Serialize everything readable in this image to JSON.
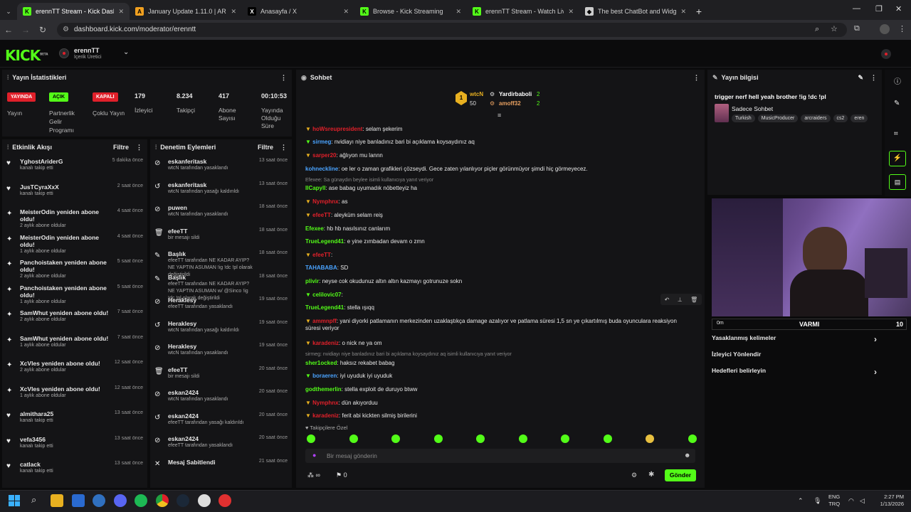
{
  "browser": {
    "tabs": [
      {
        "title": "erennTT Stream - Kick Dashboa",
        "color": "#53fc18",
        "glyph": "K"
      },
      {
        "title": "January Update 1.11.0 | ARC Ra",
        "color": "#f0a020",
        "glyph": "A"
      },
      {
        "title": "Anasayfa / X",
        "color": "#000000",
        "glyph": "X"
      },
      {
        "title": "Browse - Kick Streaming",
        "color": "#53fc18",
        "glyph": "K"
      },
      {
        "title": "erennTT Stream - Watch Live o",
        "color": "#53fc18",
        "glyph": "K"
      },
      {
        "title": "The best ChatBot and Widgets",
        "color": "#cccccc",
        "glyph": "◆"
      }
    ],
    "url": "dashboard.kick.com/moderator/erenntt"
  },
  "header": {
    "logo": "KICK",
    "beta": "BETA",
    "channel": "erennTT",
    "role": "İçerik Üretici"
  },
  "stats": {
    "title": "Yayın İstatistikleri",
    "items": [
      {
        "badge": "YAYINDA",
        "badge_color": "#e0202a",
        "label": "Yayın"
      },
      {
        "badge": "AÇIK",
        "badge_color": "#53fc18",
        "label": "Partnerlik Gelir Programı"
      },
      {
        "badge": "KAPALI",
        "badge_color": "#e0202a",
        "label": "Çoklu Yayın"
      }
    ],
    "nums": [
      {
        "value": "179",
        "label": "İzleyici"
      },
      {
        "value": "8.234",
        "label": "Takipçi"
      },
      {
        "value": "417",
        "label": "Abone Sayısı"
      },
      {
        "value": "00:10:53",
        "label": "Yayında Olduğu Süre"
      }
    ]
  },
  "activity": {
    "title": "Etkinlik Akışı",
    "filter": "Filtre",
    "items": [
      {
        "icon": "♥",
        "name": "YghostAriderG",
        "sub": "kanalı takip etti",
        "time": "5 dakika önce"
      },
      {
        "icon": "♥",
        "name": "JusTCyraXxX",
        "sub": "kanalı takip etti",
        "time": "2 saat önce"
      },
      {
        "icon": "✦",
        "name": "MeisterOdin yeniden abone oldu!",
        "sub": "2 aylık abone oldular",
        "time": "4 saat önce"
      },
      {
        "icon": "✦",
        "name": "MeisterOdin yeniden abone oldu!",
        "sub": "1 aylık abone oldular",
        "time": "4 saat önce"
      },
      {
        "icon": "✦",
        "name": "Panchoistaken yeniden abone oldu!",
        "sub": "2 aylık abone oldular",
        "time": "5 saat önce"
      },
      {
        "icon": "✦",
        "name": "Panchoistaken yeniden abone oldu!",
        "sub": "1 aylık abone oldular",
        "time": "5 saat önce"
      },
      {
        "icon": "✦",
        "name": "SamWhut yeniden abone oldu!",
        "sub": "2 aylık abone oldular",
        "time": "7 saat önce"
      },
      {
        "icon": "✦",
        "name": "SamWhut yeniden abone oldu!",
        "sub": "1 aylık abone oldular",
        "time": "7 saat önce"
      },
      {
        "icon": "✦",
        "name": "XcVles yeniden abone oldu!",
        "sub": "2 aylık abone oldular",
        "time": "12 saat önce"
      },
      {
        "icon": "✦",
        "name": "XcVles yeniden abone oldu!",
        "sub": "1 aylık abone oldular",
        "time": "12 saat önce"
      },
      {
        "icon": "♥",
        "name": "almithara25",
        "sub": "kanalı takip etti",
        "time": "13 saat önce"
      },
      {
        "icon": "♥",
        "name": "vefa3456",
        "sub": "kanalı takip etti",
        "time": "13 saat önce"
      },
      {
        "icon": "♥",
        "name": "catlack",
        "sub": "kanalı takip etti",
        "time": "13 saat önce"
      }
    ]
  },
  "moderation": {
    "title": "Denetim Eylemleri",
    "filter": "Filtre",
    "items": [
      {
        "icon": "⊘",
        "name": "eskanferitask",
        "sub": "wtcN tarafından yasaklandı",
        "time": "13 saat önce"
      },
      {
        "icon": "↺",
        "name": "eskanferitask",
        "sub": "wtcN tarafından yasağı kaldırıldı",
        "time": "13 saat önce"
      },
      {
        "icon": "⊘",
        "name": "puwen",
        "sub": "wtcN tarafından yasaklandı",
        "time": "18 saat önce"
      },
      {
        "icon": "🗑",
        "name": "efeeTT",
        "sub": "bir mesajı sildi",
        "time": "18 saat önce"
      },
      {
        "icon": "✎",
        "name": "Başlık",
        "sub": "efeeTT tarafından NE KADAR AYIP? NE YAPTIN ASUMAN !ig !dc !pl olarak değiştirildi",
        "time": "18 saat önce"
      },
      {
        "icon": "✎",
        "name": "Başlık",
        "sub": "efeeTT tarafından NE KADAR AYIP? NE YAPTIN ASUMAN w/ @Sinco !ig !dc !pl olarak değiştirildi",
        "time": "18 saat önce"
      },
      {
        "icon": "⊘",
        "name": "Heraklesy",
        "sub": "efeeTT tarafından yasaklandı",
        "time": "19 saat önce"
      },
      {
        "icon": "↺",
        "name": "Heraklesy",
        "sub": "wtcN tarafından yasağı kaldırıldı",
        "time": "19 saat önce"
      },
      {
        "icon": "⊘",
        "name": "Heraklesy",
        "sub": "wtcN tarafından yasaklandı",
        "time": "19 saat önce"
      },
      {
        "icon": "🗑",
        "name": "efeeTT",
        "sub": "bir mesajı sildi",
        "time": "20 saat önce"
      },
      {
        "icon": "⊘",
        "name": "eskan2424",
        "sub": "wtcN tarafından yasaklandı",
        "time": "20 saat önce"
      },
      {
        "icon": "↺",
        "name": "eskan2424",
        "sub": "efeeTT tarafından yasağı kaldırıldı",
        "time": "20 saat önce"
      },
      {
        "icon": "⊘",
        "name": "eskan2424",
        "sub": "efeeTT tarafından yasaklandı",
        "time": "20 saat önce"
      },
      {
        "icon": "✕",
        "name": "Mesaj Sabitlendi",
        "sub": "",
        "time": "21 saat önce"
      }
    ]
  },
  "chat": {
    "title": "Sohbet",
    "top": [
      {
        "name": "wtcN",
        "count": "50"
      },
      {
        "name": "Yardirbaboli",
        "count": "2"
      },
      {
        "name": "amoff32",
        "count": "2"
      }
    ],
    "messages": [
      {
        "user": "hoWsreupresident",
        "color": "#e0202a",
        "text": "selam şekerim",
        "system": false
      },
      {
        "user": "sirmeg",
        "color": "#4aa3ff",
        "text": "nvidiayı niye banladınız bari bi açıklama koysaydınız aq",
        "system": false
      },
      {
        "user": "sarper20",
        "color": "#e0202a",
        "text": "ağlıyon mu lannn",
        "system": false
      },
      {
        "user": "kohneckline",
        "color": "#4aa3ff",
        "text": "oe ler o zaman grafikleri çözseydi. Gece zaten yılanlıyor piçler görünmüyor şimdi hiç görmeyecez.",
        "system": false
      },
      {
        "user": "",
        "color": "#888",
        "text": "Efexee: Sa günaydın beylee isimli kullanıcıya yanıt veriyor",
        "system": true
      },
      {
        "user": "IlCapyll",
        "color": "#53fc18",
        "text": "ase babag uyumadık nöbetteyiz ha",
        "system": false
      },
      {
        "user": "Nymphnx",
        "color": "#e0202a",
        "text": "as",
        "system": false
      },
      {
        "user": "efeeTT",
        "color": "#e0202a",
        "text": "aleyküm selam reiş",
        "system": false
      },
      {
        "user": "Efexee",
        "color": "#53fc18",
        "text": "hb hb nasılsınız canlarım",
        "system": false
      },
      {
        "user": "TrueLegend41",
        "color": "#53fc18",
        "text": "e yine zımbadan devam o zmn",
        "system": false
      },
      {
        "user": "efeeTT",
        "color": "#e0202a",
        "text": "",
        "system": false
      },
      {
        "user": "TAHABABA",
        "color": "#4aa3ff",
        "text": "SD",
        "system": false
      },
      {
        "user": "plivir",
        "color": "#53fc18",
        "text": "neyse cok okudunuz altın altın kazmayı gotrunuze sokn",
        "system": false
      },
      {
        "user": "celilovic07",
        "color": "#53fc18",
        "text": "",
        "system": false
      },
      {
        "user": "TrueLegend41",
        "color": "#53fc18",
        "text": "stella ışıqq",
        "system": false
      },
      {
        "user": "ammnpff",
        "color": "#e0202a",
        "text": "yani diyorki patlamanın merkezinden uzaklaştıkça damage azalıyor ve patlama süresi 1,5 sn ye çıkartılmış buda oyunculara reaksiyon süresi veriyor",
        "system": false
      },
      {
        "user": "karadeniz",
        "color": "#e0202a",
        "text": "o nick ne ya om",
        "system": false
      },
      {
        "user": "",
        "color": "#888",
        "text": "sirmeg: nvidiayı niye banladınız bari bi açıklama koysaydınız aq isimli kullanıcıya yanıt veriyor",
        "system": true
      },
      {
        "user": "sher1ocked",
        "color": "#53fc18",
        "text": "haksız rekabet babag",
        "system": false
      },
      {
        "user": "boraeren",
        "color": "#4aa3ff",
        "text": "iyi uyuduk iyi uyuduk",
        "system": false
      },
      {
        "user": "godthemerlin",
        "color": "#53fc18",
        "text": "stella exploit de duruyo btww",
        "system": false
      },
      {
        "user": "Nymphnx",
        "color": "#e0202a",
        "text": "dün akıyorduu",
        "system": false
      },
      {
        "user": "karadeniz",
        "color": "#e0202a",
        "text": "ferit abi kickten silmiş birilerini",
        "system": false
      }
    ],
    "emote_section": "Takipçilere Özel",
    "placeholder": "Bir mesaj gönderin",
    "send": "Gönder",
    "points": "∞",
    "zero": "0"
  },
  "stream_info": {
    "title": "Yayın bilgisi",
    "stream_title": "trigger nerf hell yeah brother !ig !dc !pl",
    "mode": "Sadece Sohbet",
    "tags": [
      "Turkish",
      "MusicProducer",
      "arcraiders",
      "cs2",
      "eren"
    ],
    "rows": [
      "Yasaklanmış kelimeler",
      "İzleyici Yönlendir",
      "Hedefleri belirleyin"
    ],
    "vote_label": "VARMI",
    "vote_count": "10",
    "vote_left": "0m"
  },
  "taskbar": {
    "lang": "ENG",
    "lang2": "TRQ",
    "time": "2:27 PM",
    "date": "1/13/2026"
  }
}
